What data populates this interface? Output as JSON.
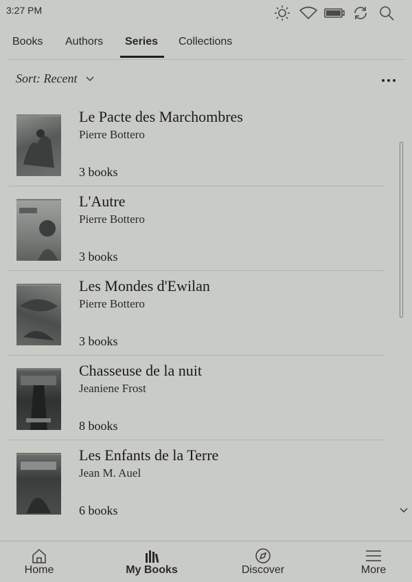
{
  "status": {
    "time": "3:27 PM"
  },
  "tabs": [
    {
      "label": "Books"
    },
    {
      "label": "Authors"
    },
    {
      "label": "Series"
    },
    {
      "label": "Collections"
    }
  ],
  "active_tab": "Series",
  "sort": {
    "label": "Sort: Recent"
  },
  "series": [
    {
      "title": "Le Pacte des Marchombres",
      "author": "Pierre Bottero",
      "count": "3 books",
      "cover_color": "#6e7270"
    },
    {
      "title": "L'Autre",
      "author": "Pierre Bottero",
      "count": "3 books",
      "cover_color": "#7c807c"
    },
    {
      "title": "Les Mondes d'Ewilan",
      "author": "Pierre Bottero",
      "count": "3 books",
      "cover_color": "#5e625f"
    },
    {
      "title": "Chasseuse de la nuit",
      "author": "Jeaniene Frost",
      "count": "8 books",
      "cover_color": "#3e413f"
    },
    {
      "title": "Les Enfants de la Terre",
      "author": "Jean M. Auel",
      "count": "6 books",
      "cover_color": "#4a4d4b"
    }
  ],
  "nav": [
    {
      "label": "Home",
      "icon": "home-icon"
    },
    {
      "label": "My Books",
      "icon": "books-icon"
    },
    {
      "label": "Discover",
      "icon": "compass-icon"
    },
    {
      "label": "More",
      "icon": "menu-icon"
    }
  ],
  "active_nav": "My Books",
  "colors": {
    "background": "#c9cbc6",
    "text": "#1e1e1e",
    "divider": "#b2b4af"
  }
}
